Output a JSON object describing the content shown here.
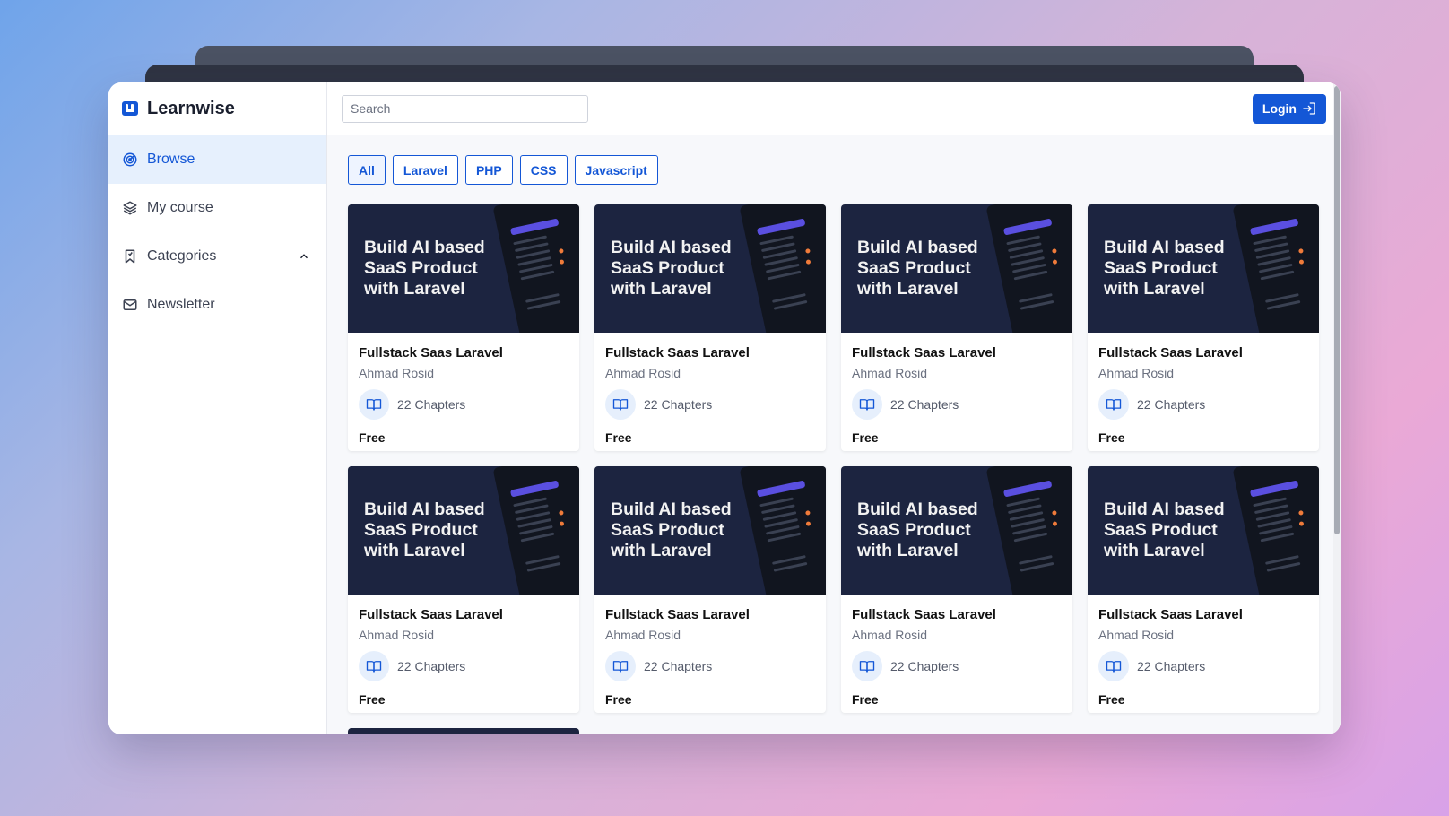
{
  "app": {
    "brand": "Learnwise"
  },
  "sidebar": {
    "items": [
      {
        "label": "Browse",
        "icon": "radar-icon",
        "active": true
      },
      {
        "label": "My course",
        "icon": "layers-icon"
      },
      {
        "label": "Categories",
        "icon": "bookmark-icon",
        "expanded": true
      },
      {
        "label": "Newsletter",
        "icon": "mail-icon"
      }
    ]
  },
  "topbar": {
    "search_placeholder": "Search",
    "login_label": "Login"
  },
  "filters": [
    "All",
    "Laravel",
    "PHP",
    "CSS",
    "Javascript"
  ],
  "courses": [
    {
      "thumb": "Build AI based SaaS Product with Laravel",
      "title": "Fullstack Saas Laravel",
      "author": "Ahmad Rosid",
      "chapters": "22 Chapters",
      "price": "Free"
    },
    {
      "thumb": "Build AI based SaaS Product with Laravel",
      "title": "Fullstack Saas Laravel",
      "author": "Ahmad Rosid",
      "chapters": "22 Chapters",
      "price": "Free"
    },
    {
      "thumb": "Build AI based SaaS Product with Laravel",
      "title": "Fullstack Saas Laravel",
      "author": "Ahmad Rosid",
      "chapters": "22 Chapters",
      "price": "Free"
    },
    {
      "thumb": "Build AI based SaaS Product with Laravel",
      "title": "Fullstack Saas Laravel",
      "author": "Ahmad Rosid",
      "chapters": "22 Chapters",
      "price": "Free"
    },
    {
      "thumb": "Build AI based SaaS Product with Laravel",
      "title": "Fullstack Saas Laravel",
      "author": "Ahmad Rosid",
      "chapters": "22 Chapters",
      "price": "Free"
    },
    {
      "thumb": "Build AI based SaaS Product with Laravel",
      "title": "Fullstack Saas Laravel",
      "author": "Ahmad Rosid",
      "chapters": "22 Chapters",
      "price": "Free"
    },
    {
      "thumb": "Build AI based SaaS Product with Laravel",
      "title": "Fullstack Saas Laravel",
      "author": "Ahmad Rosid",
      "chapters": "22 Chapters",
      "price": "Free"
    },
    {
      "thumb": "Build AI based SaaS Product with Laravel",
      "title": "Fullstack Saas Laravel",
      "author": "Ahmad Rosid",
      "chapters": "22 Chapters",
      "price": "Free"
    }
  ],
  "colors": {
    "accent": "#1457d6",
    "active_bg": "#e6f0fd",
    "thumb_bg": "#1c2440"
  }
}
